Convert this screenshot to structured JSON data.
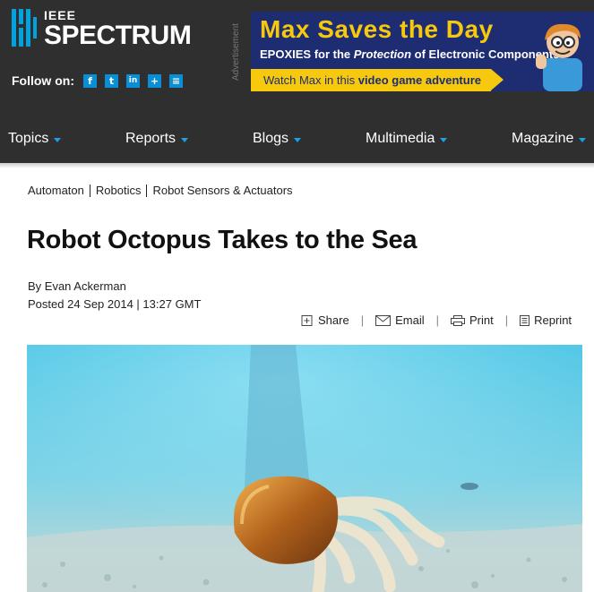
{
  "site": {
    "logo_small": "IEEE",
    "logo_large": "SPECTRUM",
    "follow_label": "Follow on:",
    "social": [
      {
        "icon": "facebook-icon",
        "glyph": "f"
      },
      {
        "icon": "twitter-icon",
        "glyph": "t"
      },
      {
        "icon": "linkedin-icon",
        "glyph": "in"
      },
      {
        "icon": "google-plus-icon",
        "glyph": "+"
      },
      {
        "icon": "rss-icon",
        "glyph": "≡"
      }
    ],
    "accent_color": "#00a3e0"
  },
  "ad": {
    "label": "Advertisement",
    "title_a": "Max ",
    "title_b": "Saves the Day",
    "subtitle_a": "EPOXIES for the ",
    "subtitle_b": "Protection",
    "subtitle_c": " of Electronic Components",
    "cta_a": "Watch Max in this ",
    "cta_b": "video game adventure"
  },
  "nav": {
    "items": [
      {
        "label": "Topics"
      },
      {
        "label": "Reports"
      },
      {
        "label": "Blogs"
      },
      {
        "label": "Multimedia"
      },
      {
        "label": "Magazine"
      }
    ]
  },
  "article": {
    "breadcrumbs": [
      "Automaton",
      "Robotics",
      "Robot Sensors & Actuators"
    ],
    "title": "Robot Octopus Takes to the Sea",
    "byline": "By Evan Ackerman",
    "posted": "Posted 24 Sep 2014 | 13:27 GMT",
    "share_actions": [
      {
        "label": "Share",
        "icon": "plus-box-icon"
      },
      {
        "label": "Email",
        "icon": "envelope-icon"
      },
      {
        "label": "Print",
        "icon": "printer-icon"
      },
      {
        "label": "Reprint",
        "icon": "document-icon"
      }
    ]
  }
}
